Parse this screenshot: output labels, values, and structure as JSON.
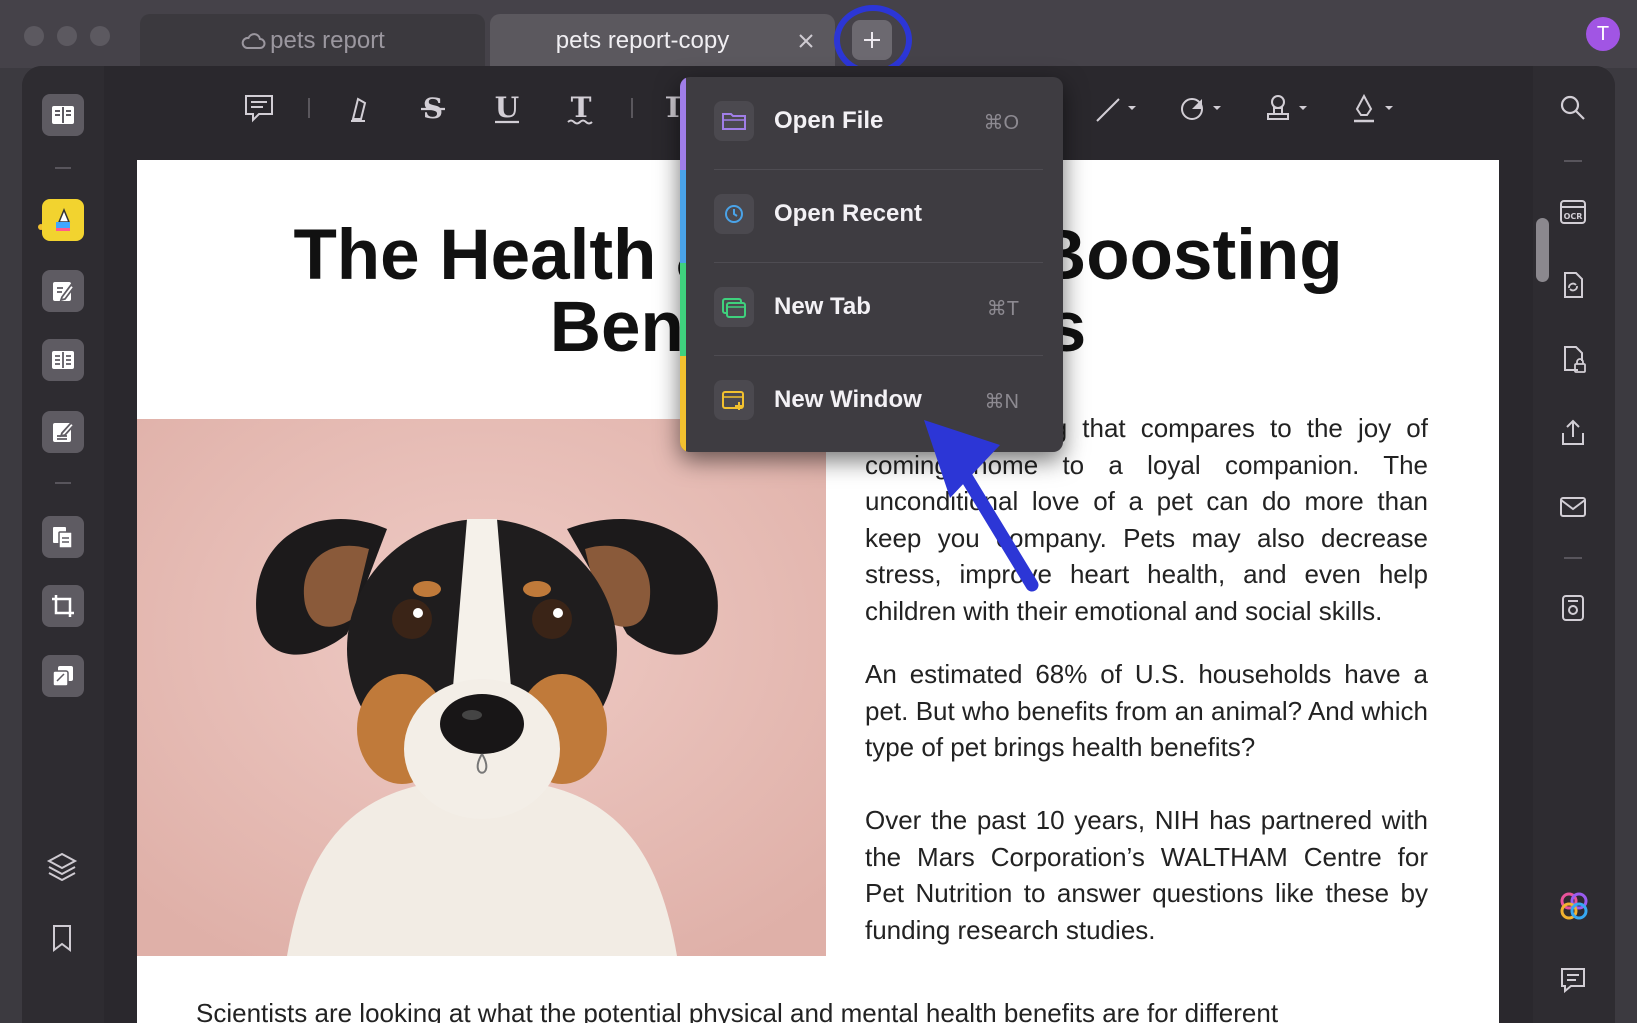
{
  "tabs": [
    {
      "label": "pets report",
      "cloud": true
    },
    {
      "label": "pets report-copy",
      "active": true
    }
  ],
  "avatar": {
    "initial": "T",
    "color": "#a155e4"
  },
  "menu": {
    "items": [
      {
        "label": "Open File",
        "shortcut": "⌘O",
        "color": "#a07ee8"
      },
      {
        "label": "Open Recent",
        "shortcut": "",
        "color": "#4aa3e8"
      },
      {
        "label": "New Tab",
        "shortcut": "⌘T",
        "color": "#3fd17d"
      },
      {
        "label": "New Window",
        "shortcut": "⌘N",
        "color": "#f2c12f"
      }
    ]
  },
  "document": {
    "title_line1": "The Health and Mood-Boosting",
    "title_line2": "Benefits of Pets",
    "para1": "There is nothing that compares to the joy of coming home to a loyal companion. The unconditional love of a pet can do more than keep you company. Pets may also decrease stress, improve heart health, and even help children with their emotional and social skills.",
    "para2": "An estimated 68% of U.S. households have a pet. But who benefits from an animal? And which type of pet brings health benefits?",
    "para3": "Over the past 10 years, NIH has partnered with the Mars Corporation’s WALTHAM Centre for Pet Nutrition to answer questions like these by funding research studies.",
    "bottom": "Scientists are looking at what the potential physical and mental health benefits are for different"
  },
  "colors": {
    "highlight": "#2c36d6",
    "accent": "#f2d32f"
  }
}
